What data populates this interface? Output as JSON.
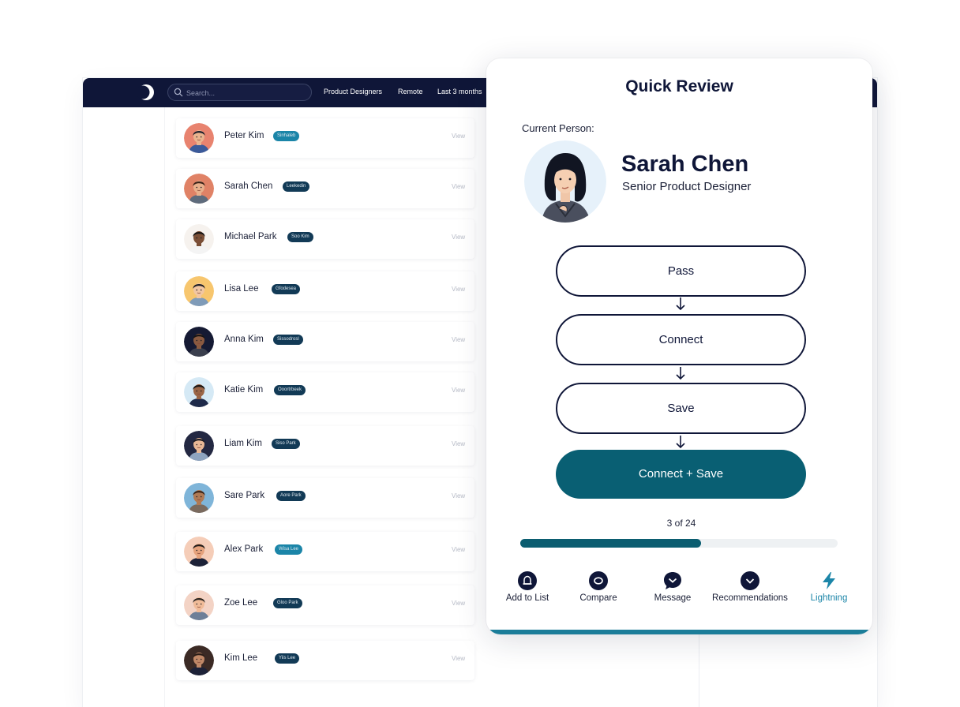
{
  "topbar": {
    "search_placeholder": "Search...",
    "filters": [
      "Product Designers",
      "Remote",
      "Last 3 months"
    ]
  },
  "people": [
    {
      "name": "Peter Kim",
      "tag": "Sinhaleb",
      "tag_style": "teal",
      "view": "View",
      "skin": "#e9b48f",
      "hair": "#1d1f2b",
      "bg": "#e8836f",
      "shirt": "#3a5a9a"
    },
    {
      "name": "Sarah Chen",
      "tag": "Leekedin",
      "tag_style": "dark",
      "view": "View",
      "skin": "#e8b08c",
      "hair": "#3a2218",
      "bg": "#e08266",
      "shirt": "#5e6b7c"
    },
    {
      "name": "Michael Park",
      "tag": "Soo Kim",
      "tag_style": "dark",
      "view": "View",
      "skin": "#7a4f36",
      "hair": "#181515",
      "bg": "#f6f2ee",
      "shirt": "#f4f4f4"
    },
    {
      "name": "Lisa Lee",
      "tag": "Gfodesea",
      "tag_style": "dark",
      "view": "View",
      "skin": "#f1c6a2",
      "hair": "#1d1d24",
      "bg": "#f7c66e",
      "shirt": "#7f9bb8"
    },
    {
      "name": "Anna Kim",
      "tag": "Sissodrosl",
      "tag_style": "dark",
      "view": "View",
      "skin": "#8a5a40",
      "hair": "#181515",
      "bg": "#151a33",
      "shirt": "#3a3f4d"
    },
    {
      "name": "Katie Kim",
      "tag": "Ooortrbeek",
      "tag_style": "dark",
      "view": "View",
      "skin": "#9a6546",
      "hair": "#181515",
      "bg": "#d5e9f5",
      "shirt": "#1e2a4a"
    },
    {
      "name": "Liam Kim",
      "tag": "Siso Park",
      "tag_style": "dark",
      "view": "View",
      "skin": "#e8b896",
      "hair": "#1c1c22",
      "bg": "#232842",
      "shirt": "#8ea4bf"
    },
    {
      "name": "Sare Park",
      "tag": "Aore Park",
      "tag_style": "dark",
      "view": "View",
      "skin": "#b07a55",
      "hair": "#3b2519",
      "bg": "#7fb5d9",
      "shirt": "#7a6a5e"
    },
    {
      "name": "Alex Park",
      "tag": "Wisa Lee",
      "tag_style": "teal",
      "view": "View",
      "skin": "#e5a27c",
      "hair": "#231d1a",
      "bg": "#f5cdb8",
      "shirt": "#1d2238"
    },
    {
      "name": "Zoe Lee",
      "tag": "Gloo Park",
      "tag_style": "dark",
      "view": "View",
      "skin": "#f0bb98",
      "hair": "#2a2420",
      "bg": "#f3d3c5",
      "shirt": "#6d7f98"
    },
    {
      "name": "Kim Lee",
      "tag": "Yiis Lee",
      "tag_style": "dark",
      "view": "View",
      "skin": "#c08867",
      "hair": "#2a1d18",
      "bg": "#3b2a25",
      "shirt": "#1d2238"
    }
  ],
  "quick_review": {
    "title": "Quick Review",
    "current_label": "Current Person:",
    "person_name": "Sarah Chen",
    "person_title": "Senior Product Designer",
    "buttons": {
      "pass": "Pass",
      "connect": "Connect",
      "save": "Save",
      "connect_save": "Connect + Save"
    },
    "progress": {
      "current": 3,
      "total": 24,
      "text": "3 of 24",
      "fill_fraction": 0.57
    },
    "actions": [
      {
        "label": "Add to List",
        "icon": "bell-icon",
        "active": false
      },
      {
        "label": "Compare",
        "icon": "compare-icon",
        "active": false
      },
      {
        "label": "Message",
        "icon": "message-icon",
        "active": false
      },
      {
        "label": "Recommendations",
        "icon": "chevron-down-icon",
        "active": false
      },
      {
        "label": "Lightning",
        "icon": "lightning-icon",
        "active": true
      }
    ]
  },
  "colors": {
    "topbar": "#0f1638",
    "primary": "#095f73",
    "accent": "#1b85a8",
    "text": "#1a1f36"
  }
}
